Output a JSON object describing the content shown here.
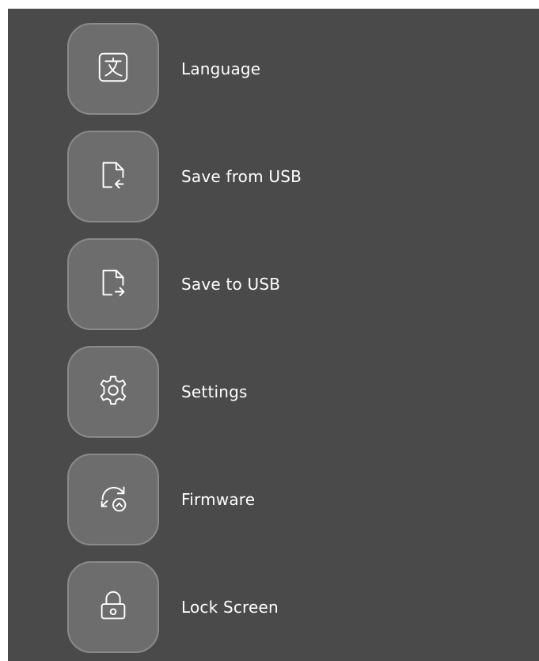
{
  "menu": {
    "items": [
      {
        "label": "Language",
        "icon": "language-icon"
      },
      {
        "label": "Save from USB",
        "icon": "file-import-icon"
      },
      {
        "label": "Save to USB",
        "icon": "file-export-icon"
      },
      {
        "label": "Settings",
        "icon": "gear-icon"
      },
      {
        "label": "Firmware",
        "icon": "firmware-update-icon"
      },
      {
        "label": "Lock Screen",
        "icon": "lock-icon"
      }
    ]
  },
  "colors": {
    "panel_background": "#4a4a4a",
    "tile_background": "#6d6d6d",
    "tile_border": "#8a8a8a",
    "text": "#ffffff"
  }
}
